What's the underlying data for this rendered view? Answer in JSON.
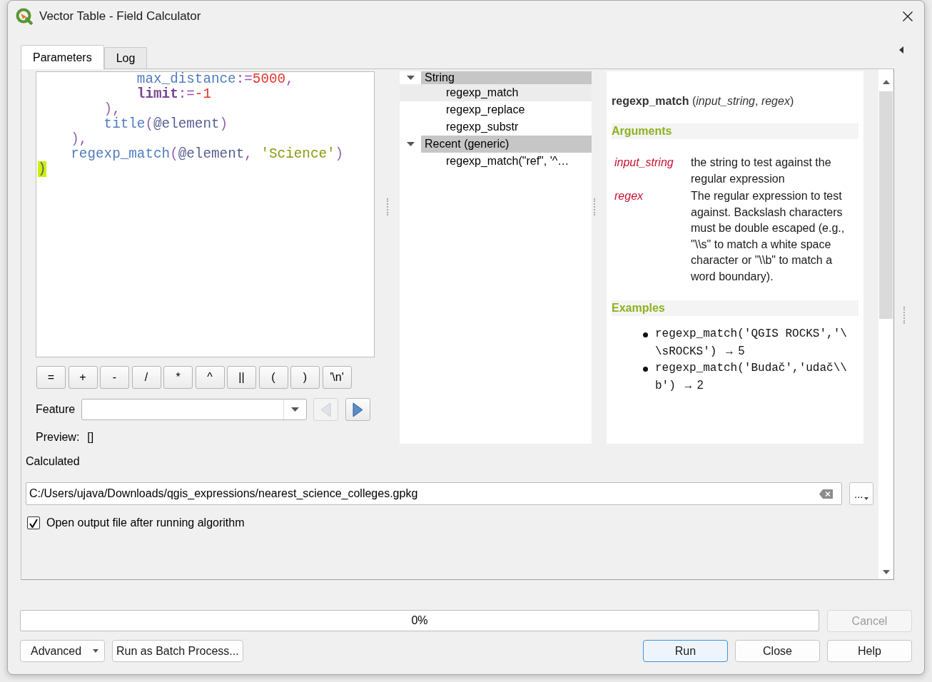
{
  "window": {
    "title": "Vector Table - Field Calculator"
  },
  "tabs": [
    {
      "label": "Parameters",
      "selected": true
    },
    {
      "label": "Log",
      "selected": false
    }
  ],
  "expression_editor": {
    "lines": [
      {
        "children": [
          {
            "children": [
              {
                "children": [
                  {
                    "tokens": [
                      {
                        "text": "max_distance",
                        "kind": "name"
                      },
                      {
                        "text": ":=",
                        "kind": "operator"
                      },
                      {
                        "text": "5000",
                        "kind": "number"
                      },
                      {
                        "text": ",",
                        "kind": "operator"
                      }
                    ]
                  },
                  {
                    "tokens": [
                      {
                        "text": "limit",
                        "kind": "keyword"
                      },
                      {
                        "text": ":=",
                        "kind": "operator"
                      },
                      {
                        "text": "-1",
                        "kind": "number"
                      }
                    ]
                  }
                ]
              },
              {
                "tokens": [
                  {
                    "text": ")",
                    "kind": "paren"
                  },
                  {
                    "text": ",",
                    "kind": "operator"
                  }
                ]
              },
              {
                "tokens": [
                  {
                    "text": "title",
                    "kind": "name"
                  },
                  {
                    "text": "(",
                    "kind": "paren"
                  },
                  {
                    "text": "@element",
                    "kind": "variable"
                  },
                  {
                    "text": ")",
                    "kind": "paren"
                  }
                ]
              }
            ]
          },
          {
            "tokens": [
              {
                "text": ")",
                "kind": "paren"
              },
              {
                "text": ",",
                "kind": "operator"
              }
            ]
          },
          {
            "tokens": [
              {
                "text": "regexp_match",
                "kind": "name"
              },
              {
                "text": "(",
                "kind": "paren"
              },
              {
                "text": "@element",
                "kind": "variable"
              },
              {
                "text": ", ",
                "kind": "operator"
              },
              {
                "text": "'Science'",
                "kind": "string"
              },
              {
                "text": ")",
                "kind": "paren"
              }
            ]
          }
        ]
      },
      {
        "tokens": [
          {
            "text": ")",
            "kind": "brace-match"
          }
        ]
      }
    ]
  },
  "operator_buttons": [
    "=",
    "+",
    "-",
    "/",
    "*",
    "^",
    "||",
    "(",
    ")",
    "'\\n'"
  ],
  "feature": {
    "label": "Feature",
    "navigation": [
      {
        "kind": "previous",
        "disabled": true
      },
      {
        "kind": "next",
        "disabled": false
      }
    ]
  },
  "preview": {
    "label": "Preview:",
    "value": "[]"
  },
  "function_tree": {
    "groups": [
      {
        "label": "String",
        "expanded": true,
        "children": [
          {
            "label": "regexp_match",
            "selected": true
          },
          {
            "label": "regexp_replace",
            "selected": false
          },
          {
            "label": "regexp_substr",
            "selected": false
          }
        ]
      },
      {
        "label": "Recent (generic)",
        "expanded": true,
        "children": [
          {
            "label": "regexp_match(\"ref\", '^…",
            "selected": false
          }
        ]
      }
    ]
  },
  "help": {
    "signature": "**regexp_match** (*input_string*, *regex*)",
    "arguments_heading": "Arguments",
    "arguments": [
      {
        "name": "input_string",
        "description": "the string to test against the regular expression"
      },
      {
        "name": "regex",
        "description": "The regular expression to test against. Backslash characters must be double escaped (e.g., \"\\\\s\" to match a white space character or \"\\\\b\" to match a word boundary)."
      }
    ],
    "examples_heading": "Examples",
    "examples": [
      {
        "code": "regexp_match('QGIS ROCKS','\\\\sROCKS')",
        "result": "→ 5"
      },
      {
        "code": "regexp_match('Budač','udač\\\\b')",
        "result": "→ 2"
      }
    ]
  },
  "output": {
    "label": "Calculated",
    "value": "C:/Users/ujava/Downloads/qgis_expressions/nearest_science_colleges.gpkg",
    "browse_label": "..."
  },
  "open_output": {
    "label": "Open output file after running algorithm",
    "checked": true
  },
  "progress": {
    "text": "0%",
    "level": 0
  },
  "cancel_button": {
    "label": "Cancel",
    "disabled": true
  },
  "left_buttons": [
    {
      "label": "Advanced",
      "kind": "menu"
    },
    {
      "label": "Run as Batch Process...",
      "kind": "plain"
    }
  ],
  "right_buttons": [
    {
      "label": "Run",
      "kind": "default"
    },
    {
      "label": "Close",
      "kind": "plain"
    },
    {
      "label": "Help",
      "kind": "plain"
    }
  ]
}
